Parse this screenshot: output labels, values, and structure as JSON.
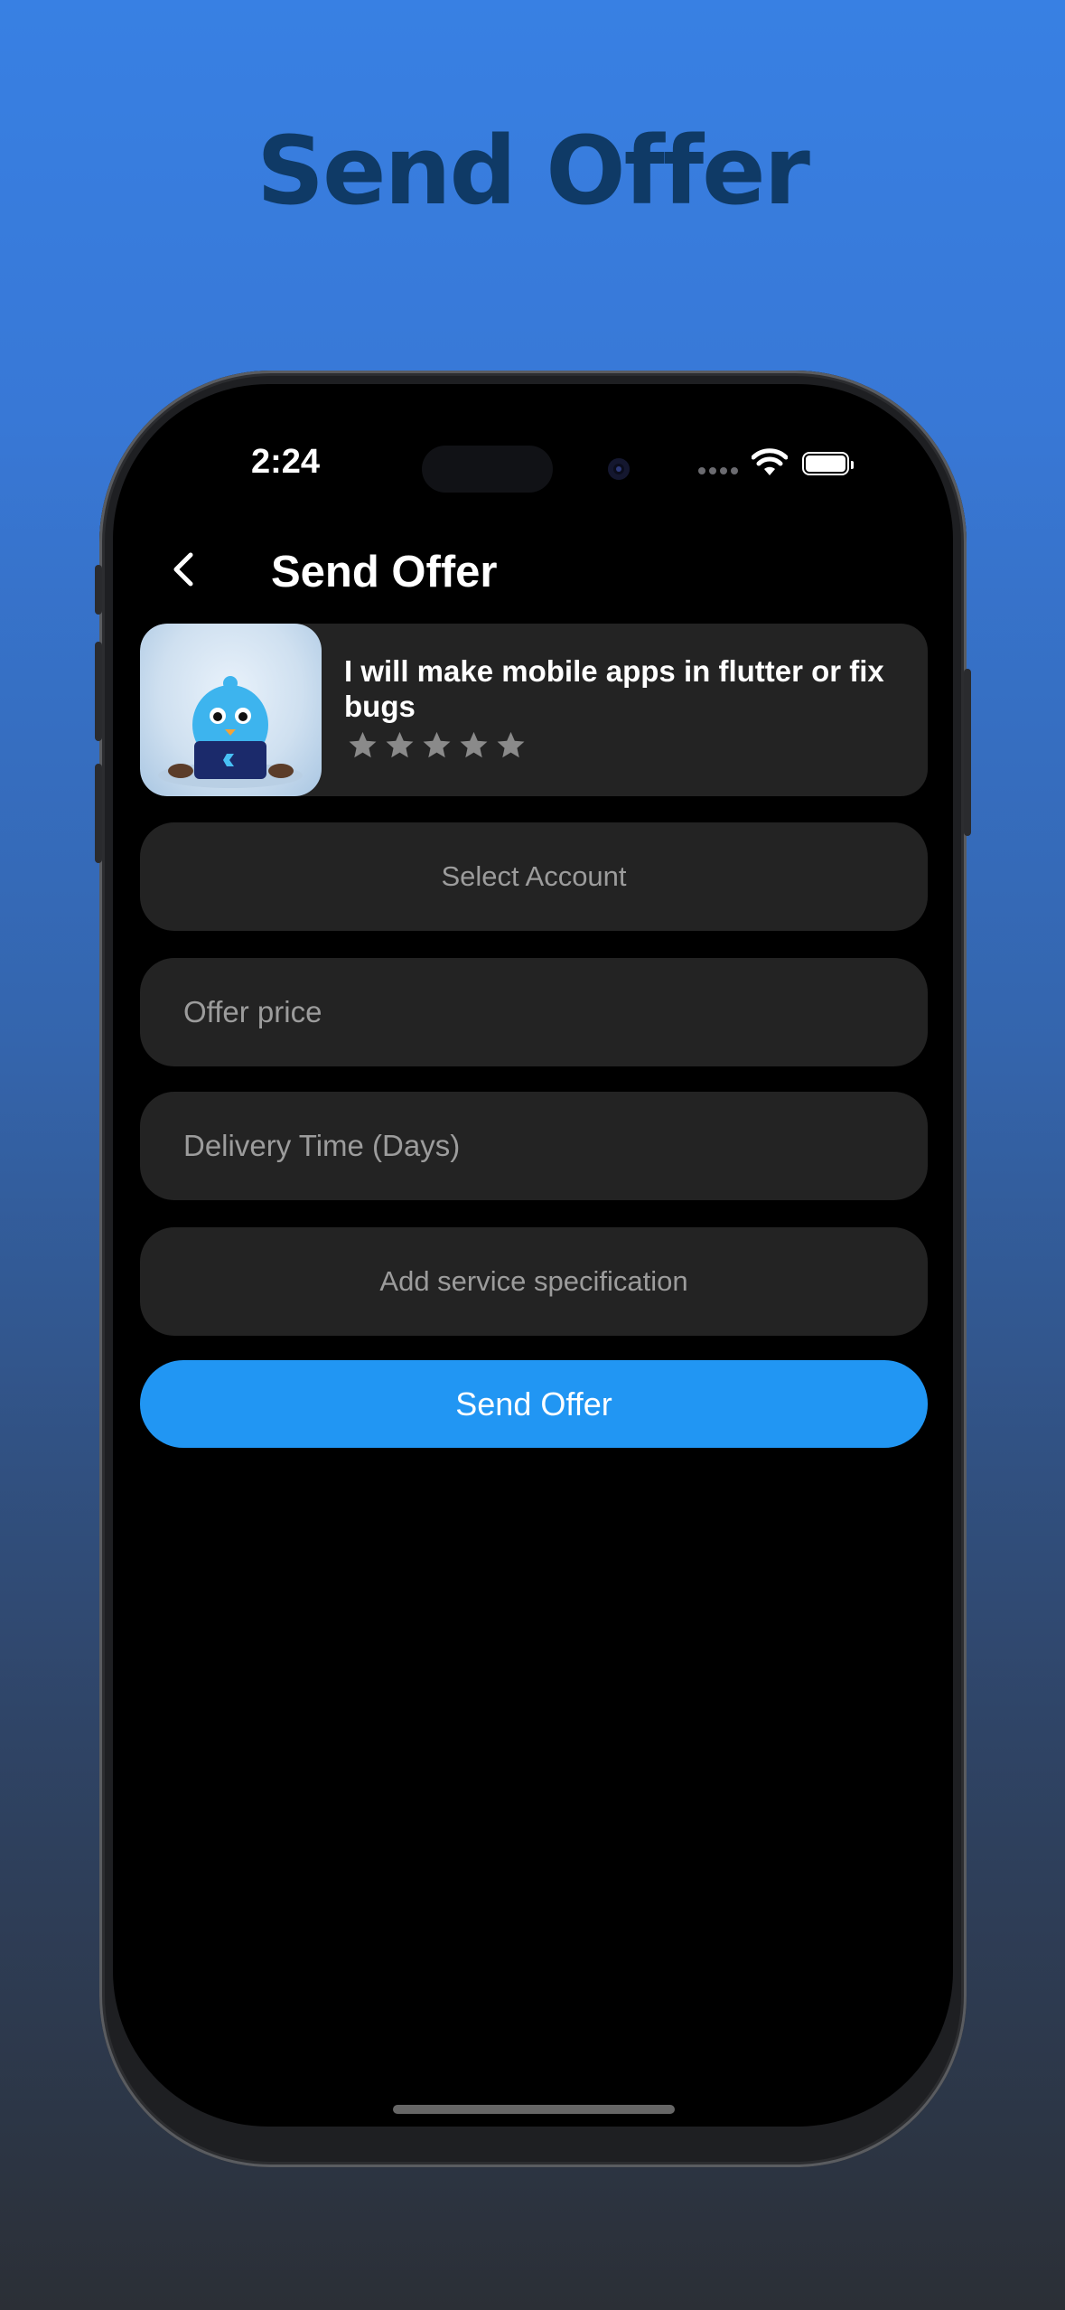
{
  "promo": {
    "title": "Send Offer"
  },
  "status_bar": {
    "time": "2:24"
  },
  "header": {
    "title": "Send Offer"
  },
  "gig": {
    "title": "I will make mobile apps in flutter or fix bugs",
    "rating": 0,
    "rating_max": 5
  },
  "form": {
    "select_account_label": "Select Account",
    "offer_price_placeholder": "Offer price",
    "delivery_time_placeholder": "Delivery Time (Days)",
    "service_spec_label": "Add service specification",
    "submit_label": "Send Offer"
  },
  "colors": {
    "accent": "#2196f3",
    "field_bg": "#232323",
    "screen_bg": "#000000",
    "promo_title": "#0f3a66",
    "star_empty": "#8a8a8a"
  },
  "icons": {
    "back": "chevron-left-icon",
    "star": "star-icon",
    "wifi": "wifi-icon",
    "battery": "battery-icon"
  }
}
